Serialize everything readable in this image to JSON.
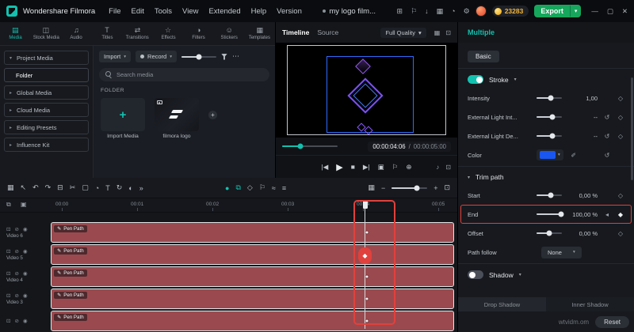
{
  "colors": {
    "accent_teal": "#12c1af",
    "export_green": "#16a75c",
    "annotation_red": "#e0413c",
    "clip_red": "#9a4a4f",
    "color_swatch_blue": "#1a56f0",
    "coin_yellow": "#f0a500"
  },
  "icons": {
    "chevron_down": "▾",
    "chevron_right": "▸",
    "more_h": "⋯",
    "more_arrows": "»",
    "minimize": "—",
    "maximize": "▢",
    "close": "✕",
    "apps": "⊞",
    "notify": "⚐",
    "download": "↓",
    "layout": "▦",
    "history": "◔",
    "settings": "⚙",
    "grid_view": "▦",
    "fullscreen": "⊡",
    "prev_frame": "|◀",
    "play": "▶",
    "stop": "■",
    "next_frame": "▶|",
    "snapshot": "▣",
    "marker": "⚐",
    "crop": "⊕",
    "volume": "♪",
    "mini": "⊟",
    "track_grid": "▦",
    "pointer": "↖",
    "undo": "↶",
    "redo": "↷",
    "trash": "⊟",
    "split": "✂",
    "crop_tool": "▢",
    "speed": "◔",
    "text_tool": "T",
    "rotate": "↻",
    "mask": "◐",
    "record": "●",
    "pip": "⧉",
    "keyframe": "◇",
    "keyframe_filled": "◆",
    "prev_keyframe": "◂",
    "wave": "≈",
    "list": "≡",
    "reset": "↺",
    "zoom_minus": "−",
    "zoom_plus": "+",
    "lock": "⊡",
    "mute": "⊘",
    "eye": "◉",
    "pen": "✎",
    "link": "⧉",
    "camera": "▣",
    "eyedropper": "✐",
    "plus": "+"
  },
  "menubar": {
    "app_name": "Wondershare Filmora",
    "menus": [
      "File",
      "Edit",
      "Tools",
      "View",
      "Extended",
      "Help",
      "Version"
    ],
    "project_title": "my logo film...",
    "coins": "23283",
    "export_label": "Export"
  },
  "media_tabs": {
    "items": [
      {
        "label": "Media",
        "glyph": "▤",
        "active": true
      },
      {
        "label": "Stock Media",
        "glyph": "◫"
      },
      {
        "label": "Audio",
        "glyph": "♫"
      },
      {
        "label": "Titles",
        "glyph": "T"
      },
      {
        "label": "Transitions",
        "glyph": "⇄"
      },
      {
        "label": "Effects",
        "glyph": "☆"
      },
      {
        "label": "Filters",
        "glyph": "◑"
      },
      {
        "label": "Stickers",
        "glyph": "☺"
      },
      {
        "label": "Templates",
        "glyph": "▦"
      }
    ]
  },
  "sidebar": {
    "items": [
      {
        "label": "Project Media",
        "chevron": "▾"
      },
      {
        "label": "Folder",
        "chevron": "",
        "active": true
      },
      {
        "label": "Global Media",
        "chevron": "▸"
      },
      {
        "label": "Cloud Media",
        "chevron": "▸"
      },
      {
        "label": "Editing Presets",
        "chevron": "▸"
      },
      {
        "label": "Influence Kit",
        "chevron": "▸"
      }
    ]
  },
  "media_panel": {
    "import_button": "Import",
    "record_button": "Record",
    "search_placeholder": "Search media",
    "section_label": "FOLDER",
    "thumb_slider_pct": 50,
    "tiles": [
      {
        "label": "Import Media"
      },
      {
        "label": "filmora logo"
      }
    ]
  },
  "preview": {
    "tabs": [
      {
        "label": "Timeline",
        "active": true
      },
      {
        "label": "Source"
      }
    ],
    "quality": "Full Quality",
    "seek_pct": 33,
    "current_time": "00:00:04:06",
    "separator": "/",
    "total_time": "00:00:05:00"
  },
  "properties": {
    "title": "Multiple",
    "tab_label": "Basic",
    "stroke_label": "Stroke",
    "stroke_enabled": true,
    "rows": {
      "intensity": {
        "label": "Intensity",
        "value": "1,00",
        "pct": 55
      },
      "ext_int": {
        "label": "External Light Int...",
        "value": "--",
        "pct": 62
      },
      "ext_de": {
        "label": "External Light De...",
        "value": "--",
        "pct": 62
      }
    },
    "color_label": "Color",
    "trim_path": {
      "label": "Trim path",
      "start": {
        "label": "Start",
        "value": "0,00 %",
        "pct": 55
      },
      "end": {
        "label": "End",
        "value": "100,00 %",
        "pct": 97,
        "highlighted": true
      },
      "offset": {
        "label": "Offset",
        "value": "0,00 %",
        "pct": 50
      },
      "path_follow_label": "Path follow",
      "path_follow_value": "None"
    },
    "shadow_label": "Shadow",
    "shadow_enabled": false,
    "bottom_tabs": [
      {
        "label": "Drop Shadow"
      },
      {
        "label": "Inner Shadow"
      }
    ],
    "reset_label": "Reset"
  },
  "timeline": {
    "zoom_pct": 70,
    "ruler": [
      "00:00",
      "00:01",
      "00:02",
      "00:03",
      "00:04",
      "00:05"
    ],
    "tracks": [
      {
        "name": "Video 6",
        "clip": "Pen Path"
      },
      {
        "name": "Video 5",
        "clip": "Pen Path"
      },
      {
        "name": "Video 4",
        "clip": "Pen Path"
      },
      {
        "name": "Video 3",
        "clip": "Pen Path"
      },
      {
        "name": "",
        "clip": "Pen Path"
      }
    ]
  },
  "watermark": "wtvidm.om"
}
